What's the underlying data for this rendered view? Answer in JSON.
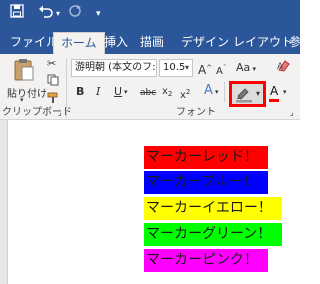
{
  "titlebar": {
    "save_icon": "save-icon",
    "undo_icon": "undo-icon",
    "redo_icon": "redo-icon",
    "customize_icon": "chevron-down-icon"
  },
  "tabs": [
    {
      "label": "ファイル"
    },
    {
      "label": "ホーム"
    },
    {
      "label": "挿入"
    },
    {
      "label": "描画"
    },
    {
      "label": "デザイン"
    },
    {
      "label": "レイアウト"
    },
    {
      "label": "参"
    }
  ],
  "ribbon": {
    "clipboard": {
      "paste_label": "貼り付け",
      "group_label": "クリップボード"
    },
    "font": {
      "font_name": "游明朝 (本文のフ:",
      "font_size": "10.5",
      "grow_label": "A",
      "shrink_label": "A",
      "case_label": "Aa",
      "bold": "B",
      "italic": "I",
      "underline": "U",
      "strike": "abc",
      "sub_base": "x",
      "sub_mark": "2",
      "sup_base": "x",
      "sup_mark": "2",
      "effects": "A",
      "font_color": "A",
      "group_label": "フォント"
    },
    "highlight_icon": "highlighter-icon",
    "highlight_selected": true
  },
  "document": {
    "lines": [
      {
        "text": "マーカーレッド！",
        "bg": "#ff0000"
      },
      {
        "text": "マーカーブルー！",
        "bg": "#0000ff"
      },
      {
        "text": "マーカーイエロー！",
        "bg": "#ffff00"
      },
      {
        "text": "マーカーグリーン！",
        "bg": "#00ff00"
      },
      {
        "text": "マーカーピンク！",
        "bg": "#ff00ff"
      }
    ]
  },
  "colors": {
    "word_blue": "#2b579a",
    "ribbon_bg": "#f3f2f1",
    "red_outline": "#ff0000"
  }
}
